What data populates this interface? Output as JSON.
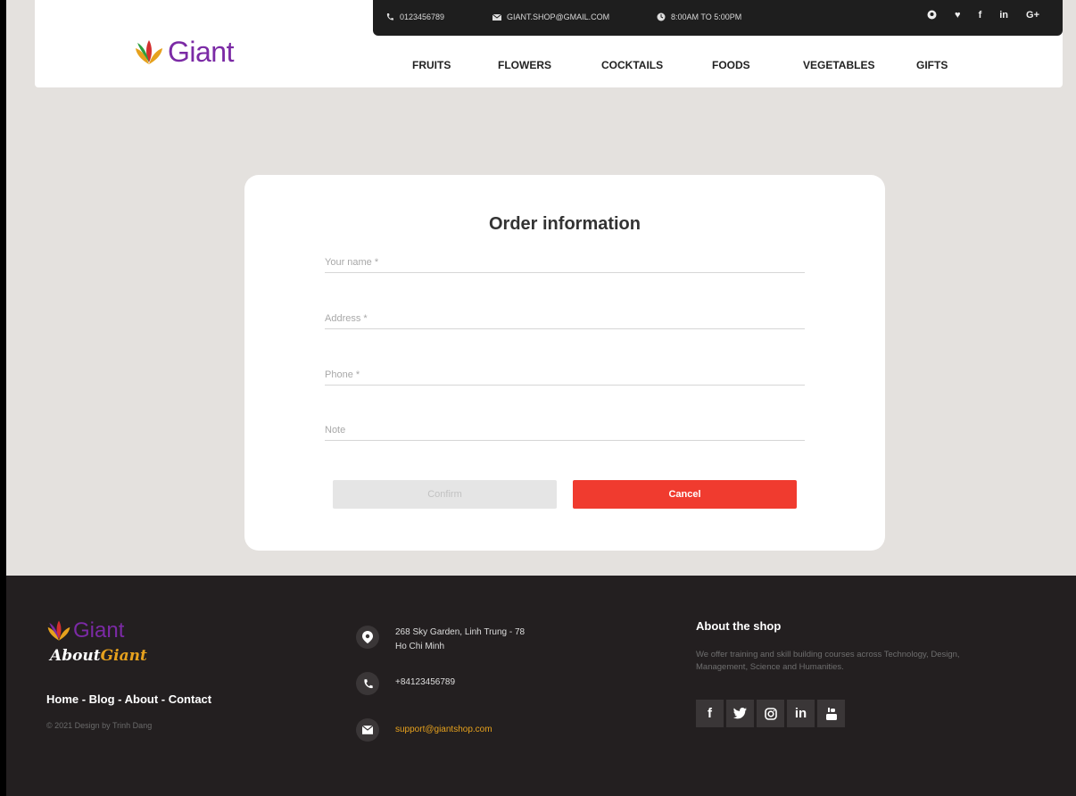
{
  "brand": {
    "name": "Giant"
  },
  "topbar": {
    "phone": "0123456789",
    "email": "GIANT.SHOP@GMAIL.COM",
    "hours": "8:00AM TO 5:00PM",
    "socials": [
      "github-icon",
      "twitter-icon",
      "facebook-icon",
      "linkedin-icon",
      "google-plus-icon"
    ],
    "social_labels": {
      "twitter": "♥",
      "facebook": "f",
      "linkedin": "in",
      "google": "G+"
    }
  },
  "nav": {
    "items": [
      "FRUITS",
      "FLOWERS",
      "COCKTAILS",
      "FOODS",
      "VEGETABLES",
      "GIFTS"
    ]
  },
  "form": {
    "title": "Order information",
    "fields": [
      {
        "placeholder": "Your name *",
        "value": ""
      },
      {
        "placeholder": "Address *",
        "value": ""
      },
      {
        "placeholder": "Phone *",
        "value": ""
      },
      {
        "placeholder": "Note",
        "value": ""
      }
    ],
    "confirm_label": "Confirm",
    "cancel_label": "Cancel"
  },
  "footer": {
    "logo_text": "Giant",
    "about_part1": "About",
    "about_part2": "Giant",
    "links": "Home - Blog - About - Contact",
    "copyright": "© 2021 Design by Trinh Dang",
    "address": "268 Sky Garden, Linh Trung - 78 Ho Chi Minh",
    "phone": "+84123456789",
    "email": "support@giantshop.com",
    "shop_title": "About the shop",
    "shop_desc": "We offer training and skill building courses across Technology, Design, Management, Science and Humanities.",
    "socials": [
      "facebook-icon",
      "twitter-icon",
      "instagram-icon",
      "linkedin-icon",
      "youtube-icon"
    ],
    "social_labels": {
      "facebook": "f",
      "linkedin": "in"
    }
  },
  "colors": {
    "brand_purple": "#7b2aa5",
    "accent_orange": "#e6a11d",
    "cancel_red": "#f03b2f"
  }
}
